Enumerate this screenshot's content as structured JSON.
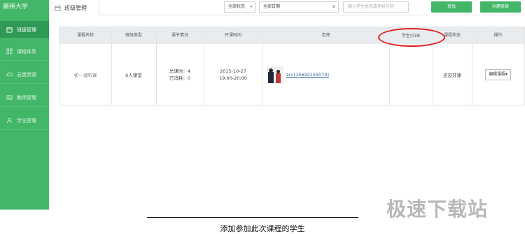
{
  "sidebar": {
    "brand": "麗稀大学",
    "items": [
      {
        "label": "班级管理",
        "icon": "calendar-icon",
        "active": true
      },
      {
        "label": "课程体系",
        "icon": "grid-icon",
        "active": false
      },
      {
        "label": "云盘资源",
        "icon": "cloud-icon",
        "active": false
      },
      {
        "label": "教师管理",
        "icon": "id-card-icon",
        "active": false
      },
      {
        "label": "学生管理",
        "icon": "person-icon",
        "active": false
      }
    ]
  },
  "header": {
    "tab_label": "班级管理",
    "status_select": "全部状态",
    "date_select": "全部日期",
    "search_placeholder": "输入学生姓名或手机号码",
    "search_button": "查找",
    "create_button": "创建班级"
  },
  "table": {
    "columns": [
      "课程名称",
      "班级类型",
      "课节情况",
      "开课时间",
      "老师",
      "学生(0)",
      "课程状态",
      "操作"
    ],
    "row": {
      "course": "初一试听课",
      "class_type": "6人课堂",
      "lessons_total": "总课时：4",
      "lessons_used": "已消耗：0",
      "date": "2015-10-27",
      "time": "19:00-20:00",
      "teacher": "zcc(15692155070)",
      "students": "",
      "status": "还没开课",
      "action": "编辑课程"
    }
  },
  "caption": "添加参加此次课程的学生",
  "watermark": "极速下载站",
  "colors": {
    "accent": "#43b768",
    "highlight": "#e02020"
  }
}
